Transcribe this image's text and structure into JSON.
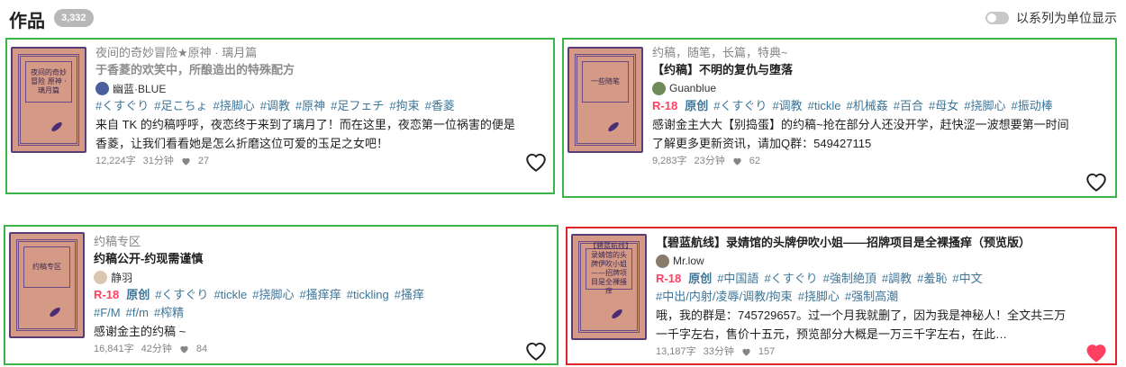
{
  "header": {
    "title": "作品",
    "count": "3,332",
    "toggle_label": "以系列为单位显示",
    "toggle_on": false
  },
  "works": [
    {
      "series": "夜间的奇妙冒险★原神 · 璃月篇",
      "title": "于香菱的欢笑中，所酿造出的特殊配方",
      "author": "幽蓝·BLUE",
      "rating": "",
      "original": "",
      "tags": [
        "#くすぐり",
        "#足こちょ",
        "#挠脚心",
        "#调教",
        "#原神",
        "#足フェチ",
        "#拘束",
        "#香菱"
      ],
      "desc": "来自 TK 的约稿呼呼，夜恋终于来到了璃月了！而在这里，夜恋第一位祸害的便是香菱，让我们看看她是怎么折磨这位可爱的玉足之女吧！",
      "chars": "12,224字",
      "minutes": "31分钟",
      "likes": "27",
      "liked": false,
      "cover_text": "夜间的奇妙冒险 原神 · 璃月篇"
    },
    {
      "series": "约稿，随笔，长篇，特典~",
      "title": "【约稿】不明的复仇与堕落",
      "author": "Guanblue",
      "rating": "R-18",
      "original": "原创",
      "tags": [
        "#くすぐり",
        "#调教",
        "#tickle",
        "#机械姦",
        "#百合",
        "#母女",
        "#挠脚心",
        "#振动棒"
      ],
      "desc": "感谢金主大大【别捣蛋】的约稿~抢在部分人还没开学，赶快涩一波想要第一时间了解更多更新资讯，请加Q群：549427115",
      "chars": "9,283字",
      "minutes": "23分钟",
      "likes": "62",
      "liked": false,
      "cover_text": "一些随笔"
    },
    {
      "series": "约稿专区",
      "title": "约稿公开-约现需谨慎",
      "author": "静羽",
      "rating": "R-18",
      "original": "原创",
      "tags": [
        "#くすぐり",
        "#tickle",
        "#挠脚心",
        "#搔痒痒",
        "#tickling",
        "#搔痒",
        "#F/M",
        "#f/m",
        "#榨精"
      ],
      "desc": "感谢金主的约稿 ~",
      "chars": "16,841字",
      "minutes": "42分钟",
      "likes": "84",
      "liked": false,
      "cover_text": "约稿专区"
    },
    {
      "series": "",
      "title": "【碧蓝航线】录婧馆的头牌伊吹小姐——招牌项目是全裸搔痒（预览版）",
      "author": "Mr.low",
      "rating": "R-18",
      "original": "原创",
      "tags": [
        "#中国語",
        "#くすぐり",
        "#強制絶頂",
        "#調教",
        "#羞恥",
        "#中文",
        "#中出/内射/凌辱/调教/拘束",
        "#挠脚心",
        "#强制高潮"
      ],
      "desc": "哦，我的群是：745729657。过一个月我就删了，因为我是神秘人！全文共三万一千字左右，售价十五元，预览部分大概是一万三千字左右，在此…",
      "chars": "13,187字",
      "minutes": "33分钟",
      "likes": "157",
      "liked": true,
      "cover_text": "【碧蓝航线】录婧馆的头牌伊吹小姐——招牌项目是全裸搔痒"
    }
  ]
}
